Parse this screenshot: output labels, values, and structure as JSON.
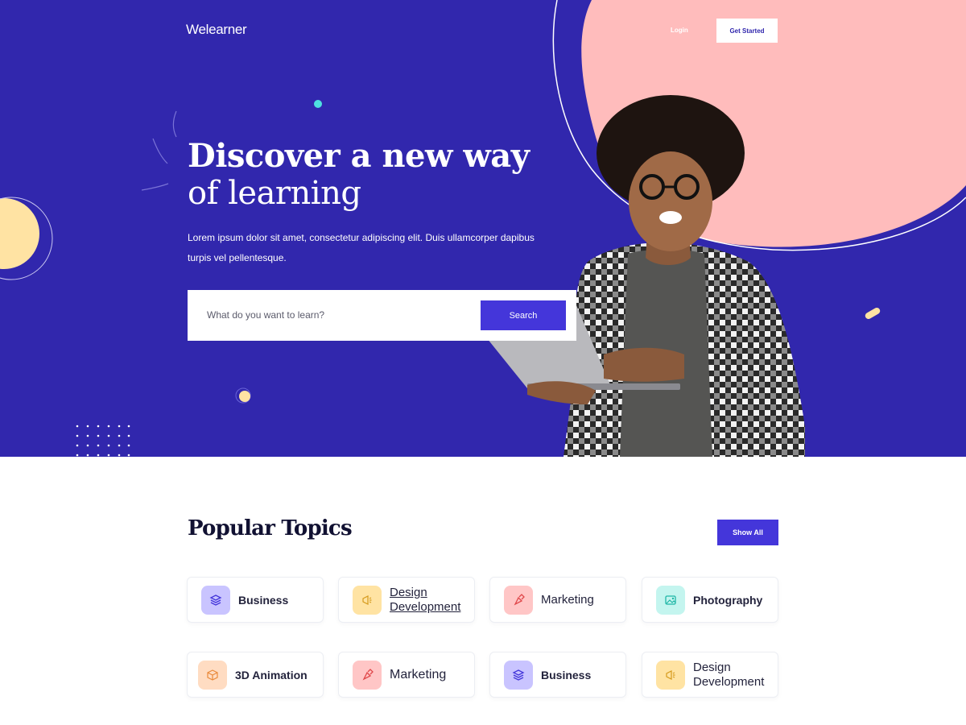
{
  "brand": {
    "logo_text": "Welearner"
  },
  "nav": {
    "login_label": "Login",
    "get_started_label": "Get Started"
  },
  "hero": {
    "headline_line1": "Discover a new way",
    "headline_line2": "of learning",
    "lead_text": "Lorem ipsum dolor sit amet, consectetur adipiscing elit. Duis ullamcorper dapibus turpis vel pellentesque.",
    "search_placeholder": "What do you want to learn?",
    "search_button_label": "Search"
  },
  "topics": {
    "title": "Popular Topics",
    "show_all_label": "Show All",
    "items": [
      {
        "label": "Business",
        "icon": "layers-icon"
      },
      {
        "label": "Design Development",
        "icon": "megaphone-icon"
      },
      {
        "label": "Marketing",
        "icon": "pen-tool-icon"
      },
      {
        "label": "Photography",
        "icon": "image-icon"
      },
      {
        "label": "3D Animation",
        "icon": "cube-icon"
      },
      {
        "label": "Marketing",
        "icon": "pen-tool-icon"
      },
      {
        "label": "Business",
        "icon": "layers-icon"
      },
      {
        "label": "Design Development",
        "icon": "megaphone-icon"
      }
    ]
  },
  "colors": {
    "hero_bg": "#3127ad",
    "accent": "#4436da",
    "blob_pink": "#ffbcbc",
    "yellow": "#ffe3a3",
    "teal": "#4ee0e0"
  }
}
